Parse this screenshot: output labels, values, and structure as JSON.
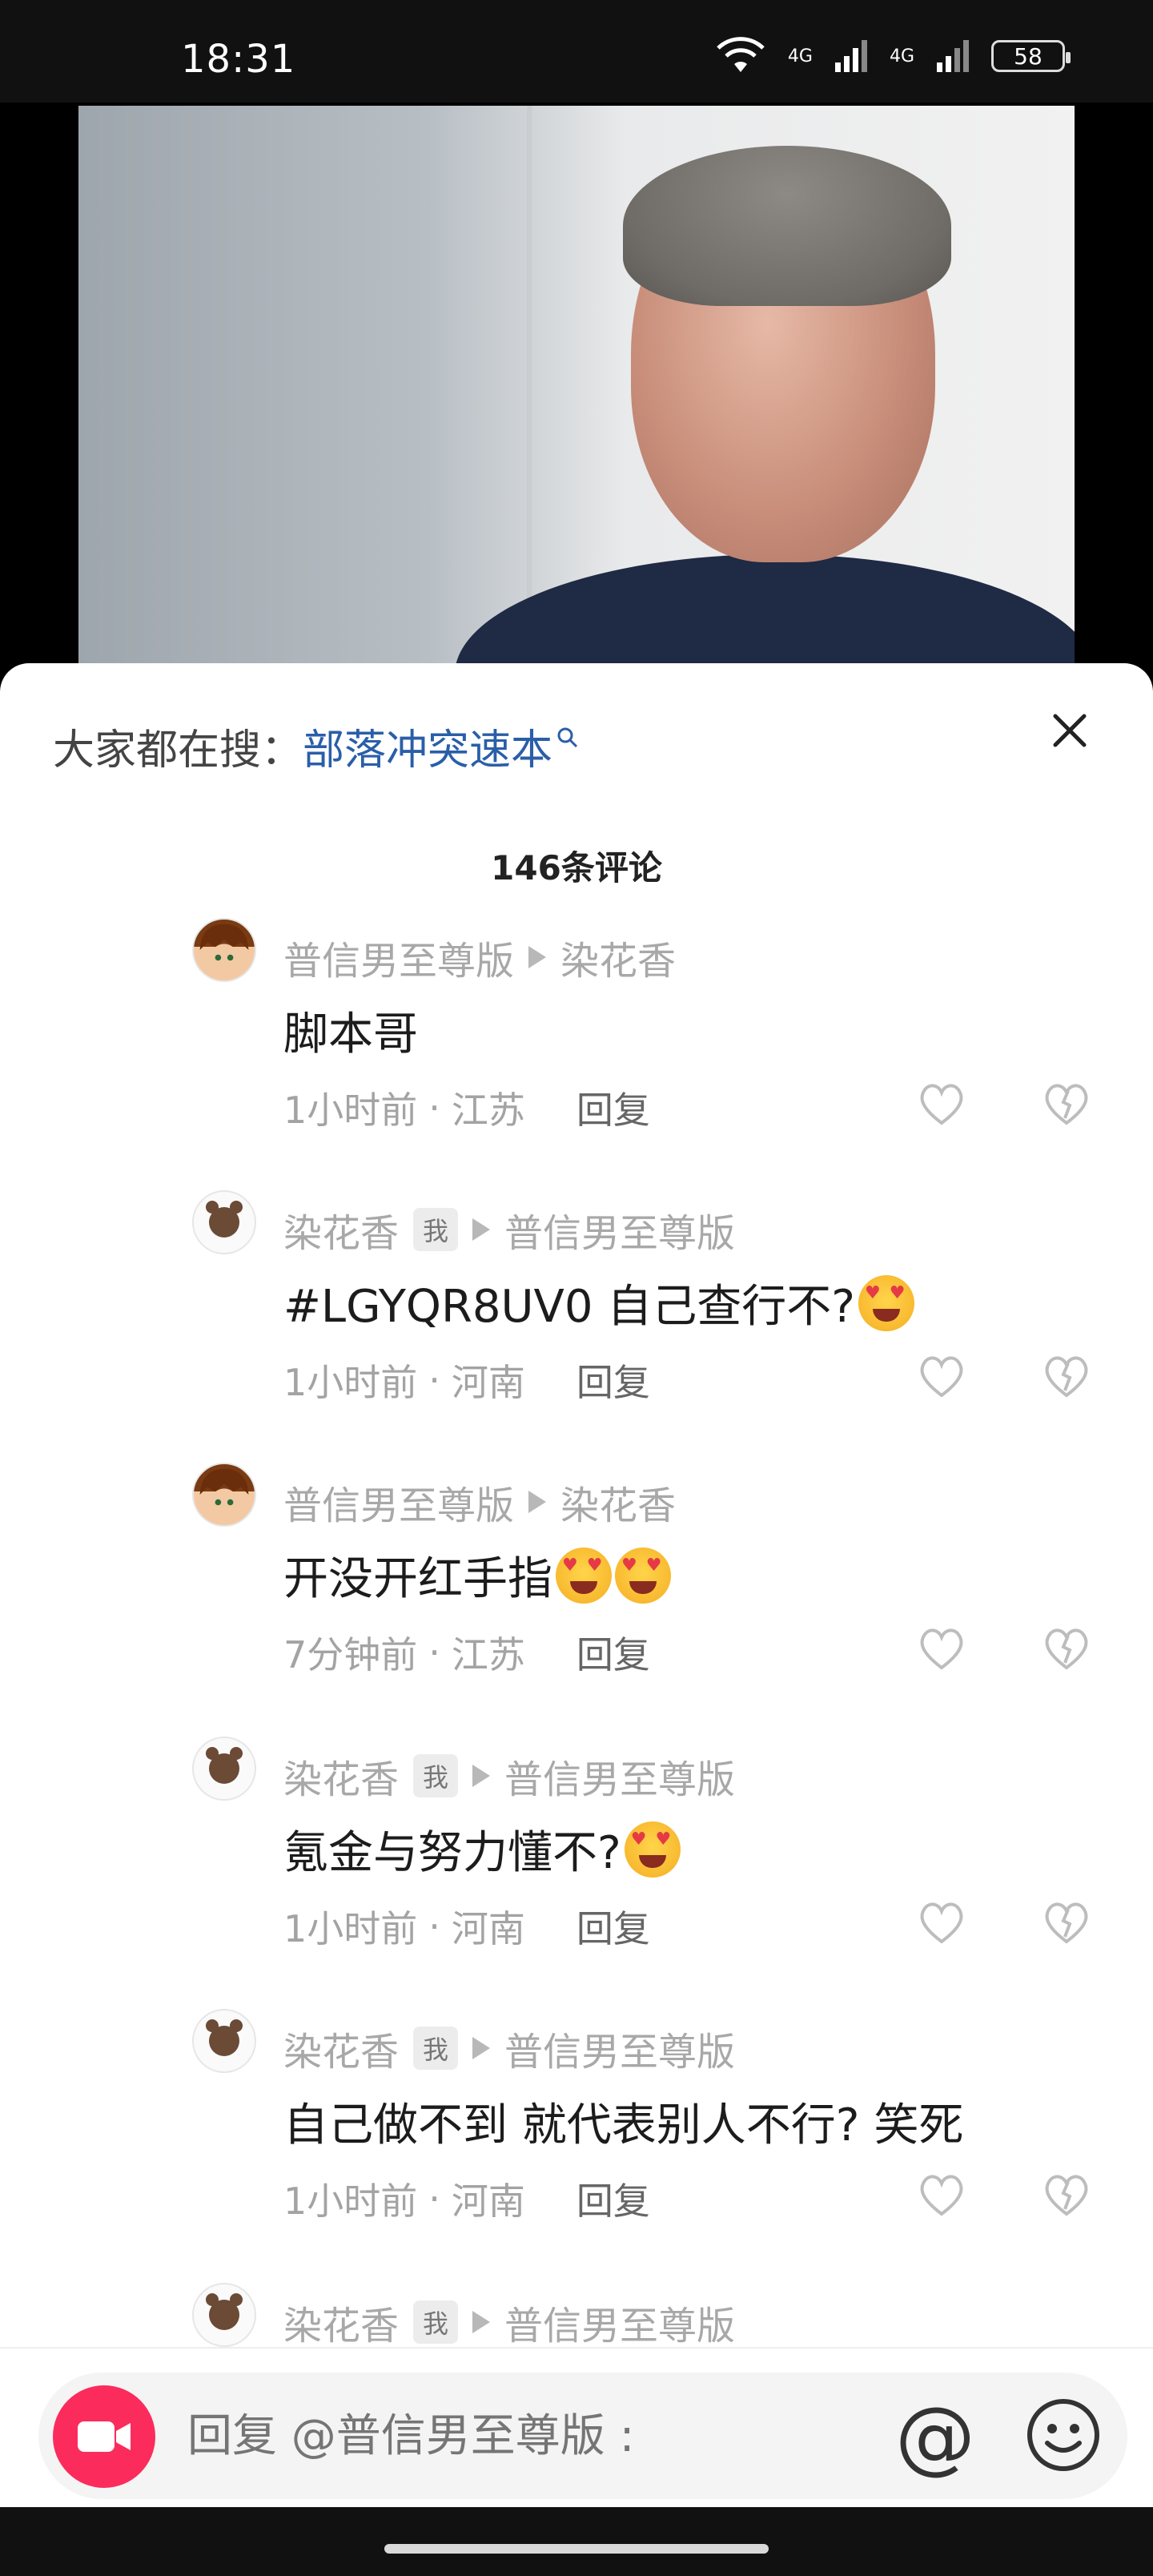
{
  "status_bar": {
    "time": "18:31",
    "battery": "58",
    "network_1": "4G",
    "network_2": "4G"
  },
  "search_hint": {
    "prefix": "大家都在搜：",
    "query": "部落冲突速本"
  },
  "comments_header": {
    "count_label": "146条评论"
  },
  "comments": [
    {
      "author": "普信男至尊版",
      "is_me": false,
      "reply_to": "染花香",
      "text": "脚本哥",
      "emoji_count": 0,
      "time": "1小时前",
      "location": "江苏",
      "reply_label": "回复",
      "avatar": "anime-avatar"
    },
    {
      "author": "染花香",
      "is_me": true,
      "me_badge": "我",
      "reply_to": "普信男至尊版",
      "text": "#LGYQR8UV0  自己查行不?",
      "emoji_count": 1,
      "time": "1小时前",
      "location": "河南",
      "reply_label": "回复",
      "avatar": "bear-avatar"
    },
    {
      "author": "普信男至尊版",
      "is_me": false,
      "reply_to": "染花香",
      "text": "开没开红手指",
      "emoji_count": 2,
      "time": "7分钟前",
      "location": "江苏",
      "reply_label": "回复",
      "avatar": "anime-avatar"
    },
    {
      "author": "染花香",
      "is_me": true,
      "me_badge": "我",
      "reply_to": "普信男至尊版",
      "text": "氪金与努力懂不?",
      "emoji_count": 1,
      "time": "1小时前",
      "location": "河南",
      "reply_label": "回复",
      "avatar": "bear-avatar"
    },
    {
      "author": "染花香",
      "is_me": true,
      "me_badge": "我",
      "reply_to": "普信男至尊版",
      "text": "自己做不到 就代表别人不行? 笑死",
      "emoji_count": 0,
      "time": "1小时前",
      "location": "河南",
      "reply_label": "回复",
      "avatar": "bear-avatar"
    },
    {
      "author": "染花香",
      "is_me": true,
      "me_badge": "我",
      "reply_to": "普信男至尊版",
      "text": "",
      "emoji_count": 0,
      "time": "",
      "location": "",
      "reply_label": "",
      "avatar": "bear-avatar"
    }
  ],
  "input_bar": {
    "placeholder": "回复 @普信男至尊版 :",
    "at_symbol": "@"
  },
  "colors": {
    "accent": "#fb2c5c",
    "link": "#2a5ea8"
  },
  "icons": [
    "wifi-icon",
    "signal-icon",
    "battery-icon",
    "close-icon",
    "like-icon",
    "dislike-icon",
    "camera-icon",
    "at-icon",
    "emoji-icon"
  ]
}
